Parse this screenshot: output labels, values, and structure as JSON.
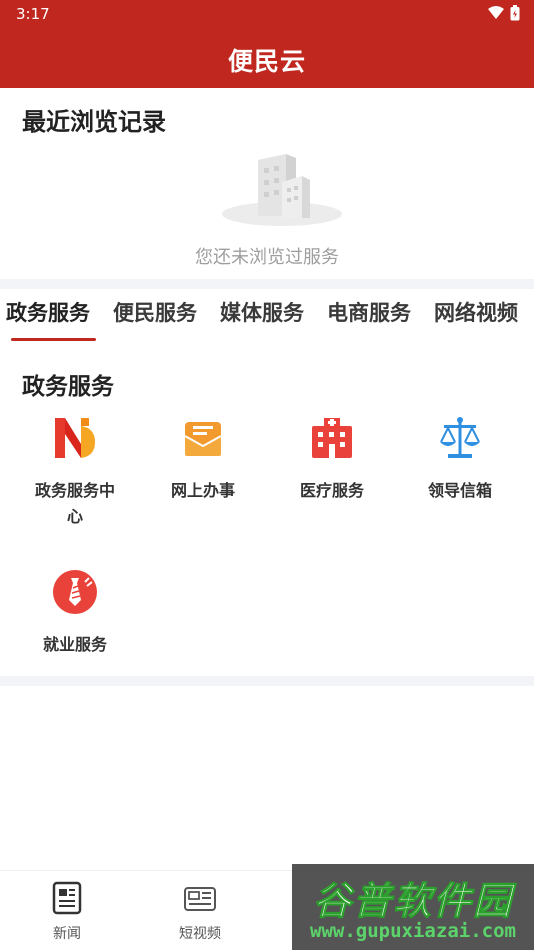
{
  "status_bar": {
    "time": "3:17"
  },
  "header": {
    "title": "便民云"
  },
  "recent": {
    "title": "最近浏览记录",
    "empty_text": "您还未浏览过服务"
  },
  "tabs": [
    {
      "label": "政务服务",
      "active": true
    },
    {
      "label": "便民服务"
    },
    {
      "label": "媒体服务"
    },
    {
      "label": "电商服务"
    },
    {
      "label": "网络视频"
    }
  ],
  "section": {
    "title": "政务服务",
    "items": [
      {
        "label": "政务服务中心",
        "icon": "gov-service-center-icon"
      },
      {
        "label": "网上办事",
        "icon": "online-affairs-icon"
      },
      {
        "label": "医疗服务",
        "icon": "hospital-icon"
      },
      {
        "label": "领导信箱",
        "icon": "scales-icon"
      },
      {
        "label": "就业服务",
        "icon": "employment-tie-icon"
      }
    ]
  },
  "bottom_nav": [
    {
      "label": "新闻",
      "icon": "newspaper-icon"
    },
    {
      "label": "短视频",
      "icon": "short-video-icon"
    }
  ],
  "watermark": {
    "title": "谷普软件园",
    "url": "www.gupuxiazai.com"
  },
  "colors": {
    "brand_red": "#c0281f",
    "divider": "#f3f4f8",
    "muted_text": "#9e9e9e",
    "icon_orange": "#f29a2e",
    "icon_red": "#e9423a",
    "icon_blue": "#2f8fe0"
  }
}
